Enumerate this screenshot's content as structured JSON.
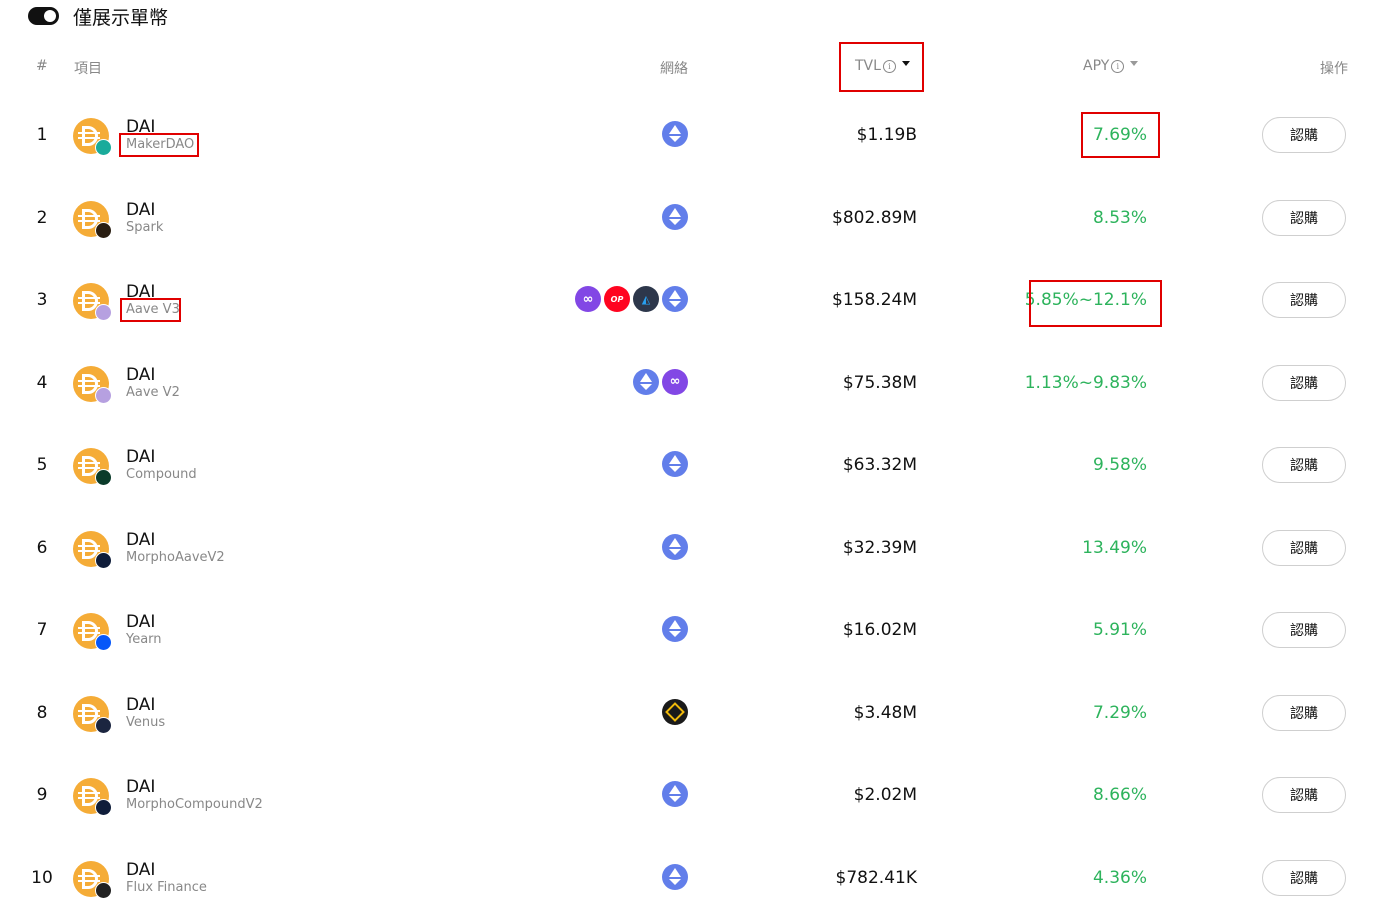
{
  "toggle": {
    "label": "僅展示單幣",
    "on": true
  },
  "headers": {
    "rank": "#",
    "project": "項目",
    "network": "網絡",
    "tvl": "TVL",
    "apy": "APY",
    "action": "操作"
  },
  "accent_green": "#2db35c",
  "highlight_color": "#e00000",
  "rows": [
    {
      "rank": "1",
      "token": "DAI",
      "protocol": "MakerDAO",
      "protocol_icon": "makerdao-icon",
      "chains": [
        "ethereum-icon"
      ],
      "tvl": "$1.19B",
      "apy": "7.69%",
      "action": "認購"
    },
    {
      "rank": "2",
      "token": "DAI",
      "protocol": "Spark",
      "protocol_icon": "spark-icon",
      "chains": [
        "ethereum-icon"
      ],
      "tvl": "$802.89M",
      "apy": "8.53%",
      "action": "認購"
    },
    {
      "rank": "3",
      "token": "DAI",
      "protocol": "Aave V3",
      "protocol_icon": "aave-icon",
      "chains": [
        "polygon-icon",
        "optimism-icon",
        "arbitrum-icon",
        "ethereum-icon"
      ],
      "tvl": "$158.24M",
      "apy": "5.85%~12.1%",
      "action": "認購"
    },
    {
      "rank": "4",
      "token": "DAI",
      "protocol": "Aave V2",
      "protocol_icon": "aave-icon",
      "chains": [
        "ethereum-icon",
        "polygon-icon"
      ],
      "tvl": "$75.38M",
      "apy": "1.13%~9.83%",
      "action": "認購"
    },
    {
      "rank": "5",
      "token": "DAI",
      "protocol": "Compound",
      "protocol_icon": "compound-icon",
      "chains": [
        "ethereum-icon"
      ],
      "tvl": "$63.32M",
      "apy": "9.58%",
      "action": "認購"
    },
    {
      "rank": "6",
      "token": "DAI",
      "protocol": "MorphoAaveV2",
      "protocol_icon": "morpho-icon",
      "chains": [
        "ethereum-icon"
      ],
      "tvl": "$32.39M",
      "apy": "13.49%",
      "action": "認購"
    },
    {
      "rank": "7",
      "token": "DAI",
      "protocol": "Yearn",
      "protocol_icon": "yearn-icon",
      "chains": [
        "ethereum-icon"
      ],
      "tvl": "$16.02M",
      "apy": "5.91%",
      "action": "認購"
    },
    {
      "rank": "8",
      "token": "DAI",
      "protocol": "Venus",
      "protocol_icon": "venus-icon",
      "chains": [
        "bnb-chain-icon"
      ],
      "tvl": "$3.48M",
      "apy": "7.29%",
      "action": "認購"
    },
    {
      "rank": "9",
      "token": "DAI",
      "protocol": "MorphoCompoundV2",
      "protocol_icon": "morpho-icon",
      "chains": [
        "ethereum-icon"
      ],
      "tvl": "$2.02M",
      "apy": "8.66%",
      "action": "認購"
    },
    {
      "rank": "10",
      "token": "DAI",
      "protocol": "Flux Finance",
      "protocol_icon": "flux-icon",
      "chains": [
        "ethereum-icon"
      ],
      "tvl": "$782.41K",
      "apy": "4.36%",
      "action": "認購"
    }
  ]
}
